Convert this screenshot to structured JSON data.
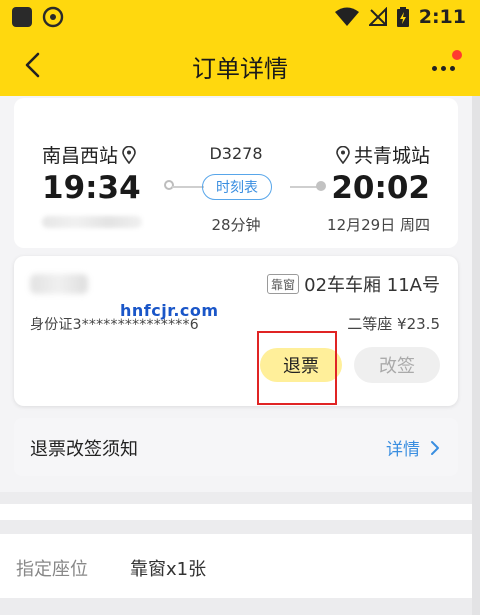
{
  "status_bar": {
    "time": "2:11"
  },
  "header": {
    "title": "订单详情"
  },
  "trip": {
    "departure_station": "南昌西站",
    "departure_time": "19:34",
    "train_number": "D3278",
    "timetable_label": "时刻表",
    "duration": "28分钟",
    "arrival_station": "共青城站",
    "arrival_time": "20:02",
    "arrival_date": "12月29日 周四"
  },
  "passenger": {
    "seat_tag": "靠窗",
    "car_seat": "02车车厢 11A号",
    "id_number": "身份证3***************6",
    "fare": "二等座  ¥23.5",
    "refund_label": "退票",
    "change_label": "改签"
  },
  "watermark": "hnfcjr.com",
  "notice": {
    "label": "退票改签须知",
    "detail": "详情"
  },
  "seat_preference": {
    "label": "指定座位",
    "value": "靠窗x1张"
  },
  "colors": {
    "brand_yellow": "#ffd80e",
    "link_blue": "#3a8ee0",
    "highlight_red": "#e02424"
  }
}
